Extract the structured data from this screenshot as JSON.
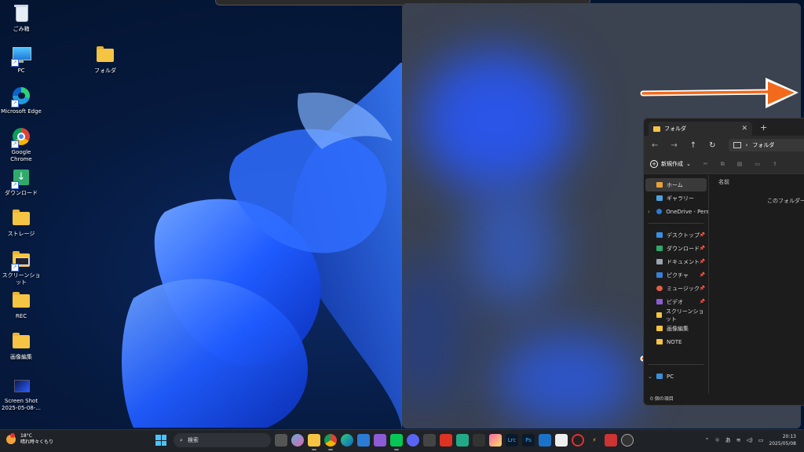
{
  "desktop": {
    "icons": [
      {
        "label": "ごみ箱",
        "icon": "recycle-bin-icon"
      },
      {
        "label": "PC",
        "icon": "pc-icon"
      },
      {
        "label": "Microsoft Edge",
        "icon": "edge-icon"
      },
      {
        "label": "Google Chrome",
        "icon": "chrome-icon"
      },
      {
        "label": "ダウンロード",
        "icon": "download-folder-icon"
      },
      {
        "label": "ストレージ",
        "icon": "folder-icon"
      },
      {
        "label": "スクリーンショット",
        "icon": "folder-icon"
      },
      {
        "label": "REC",
        "icon": "folder-icon"
      },
      {
        "label": "画像編集",
        "icon": "folder-icon"
      },
      {
        "label": "Screen Shot 2025-05-08-...",
        "icon": "image-file-icon"
      },
      {
        "label": "フォルダ",
        "icon": "folder-icon"
      }
    ]
  },
  "explorer": {
    "tab_title": "フォルダ",
    "address_path": "フォルダ",
    "new_button": "新規作成",
    "column_name": "名前",
    "empty_message": "このフォルダーは空",
    "status": "0 個の項目",
    "sidebar": [
      {
        "label": "ホーム",
        "color": "#e9a13b"
      },
      {
        "label": "ギャラリー",
        "color": "#4aa3e0"
      },
      {
        "label": "OneDrive - Perso",
        "color": "#2a7ad8"
      },
      {
        "label": "デスクトップ",
        "color": "#3b8fe0"
      },
      {
        "label": "ダウンロード",
        "color": "#2fa86a"
      },
      {
        "label": "ドキュメント",
        "color": "#9aa5b1"
      },
      {
        "label": "ピクチャ",
        "color": "#3a7fd5"
      },
      {
        "label": "ミュージック",
        "color": "#e05f45"
      },
      {
        "label": "ビデオ",
        "color": "#8b5cd6"
      },
      {
        "label": "スクリーンショット",
        "color": "#f5c443"
      },
      {
        "label": "画像編集",
        "color": "#f5c443"
      },
      {
        "label": "NOTE",
        "color": "#f5c443"
      },
      {
        "label": "PC",
        "color": "#3a8fd8"
      }
    ]
  },
  "taskbar": {
    "weather_temp": "18°C",
    "weather_desc": "晴れ時々くもり",
    "search_placeholder": "検索",
    "ime": "あ",
    "time": "20:13",
    "date": "2025/05/08"
  },
  "colors": {
    "accent": "#4cc2ff",
    "arrow": "#f26a1b"
  }
}
